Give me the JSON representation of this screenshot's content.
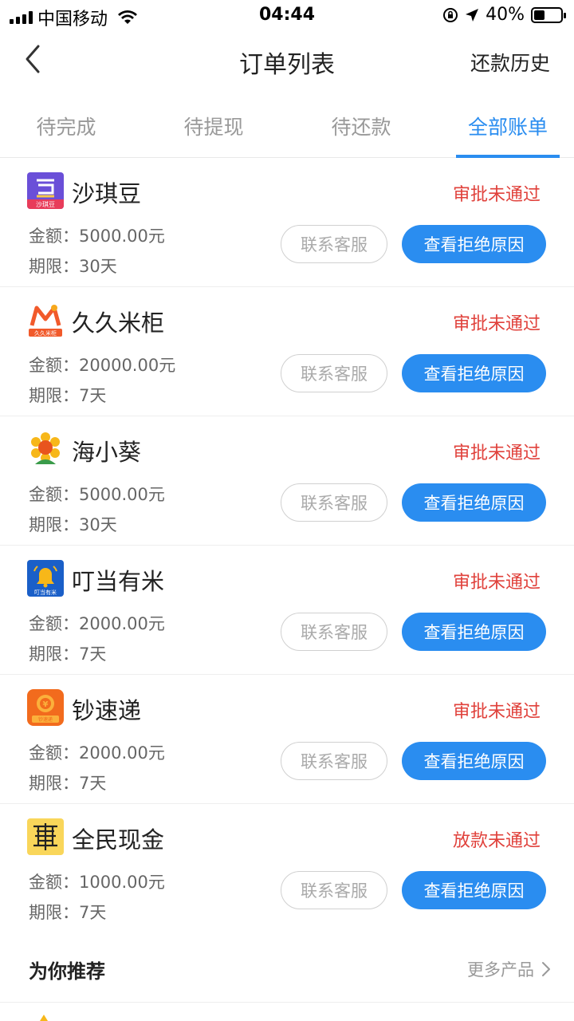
{
  "status_bar": {
    "carrier": "中国移动",
    "time": "04:44",
    "battery": "40%",
    "battery_level": 0.4
  },
  "nav": {
    "title": "订单列表",
    "right_label": "还款历史"
  },
  "tabs": [
    {
      "label": "待完成",
      "active": false
    },
    {
      "label": "待提现",
      "active": false
    },
    {
      "label": "待还款",
      "active": false
    },
    {
      "label": "全部账单",
      "active": true
    }
  ],
  "orders": [
    {
      "name": "沙琪豆",
      "status": "审批未通过",
      "amount": "金额：5000.00元",
      "term": "期限：30天",
      "logo_text": "沙琪豆",
      "btn_contact": "联系客服",
      "btn_reason": "查看拒绝原因"
    },
    {
      "name": "久久米柜",
      "status": "审批未通过",
      "amount": "金额：20000.00元",
      "term": "期限：7天",
      "logo_text": "久久米柜",
      "btn_contact": "联系客服",
      "btn_reason": "查看拒绝原因"
    },
    {
      "name": "海小葵",
      "status": "审批未通过",
      "amount": "金额：5000.00元",
      "term": "期限：30天",
      "btn_contact": "联系客服",
      "btn_reason": "查看拒绝原因"
    },
    {
      "name": "叮当有米",
      "status": "审批未通过",
      "amount": "金额：2000.00元",
      "term": "期限：7天",
      "logo_text": "叮当有米",
      "btn_contact": "联系客服",
      "btn_reason": "查看拒绝原因"
    },
    {
      "name": "钞速递",
      "status": "审批未通过",
      "amount": "金额：2000.00元",
      "term": "期限：7天",
      "logo_text": "钞速递",
      "btn_contact": "联系客服",
      "btn_reason": "查看拒绝原因"
    },
    {
      "name": "全民现金",
      "status": "放款未通过",
      "amount": "金额：1000.00元",
      "term": "期限：7天",
      "btn_contact": "联系客服",
      "btn_reason": "查看拒绝原因"
    }
  ],
  "recommend": {
    "title": "为你推荐",
    "more": "更多产品"
  },
  "colors": {
    "accent": "#2a8df0",
    "status_red": "#e0413b"
  }
}
